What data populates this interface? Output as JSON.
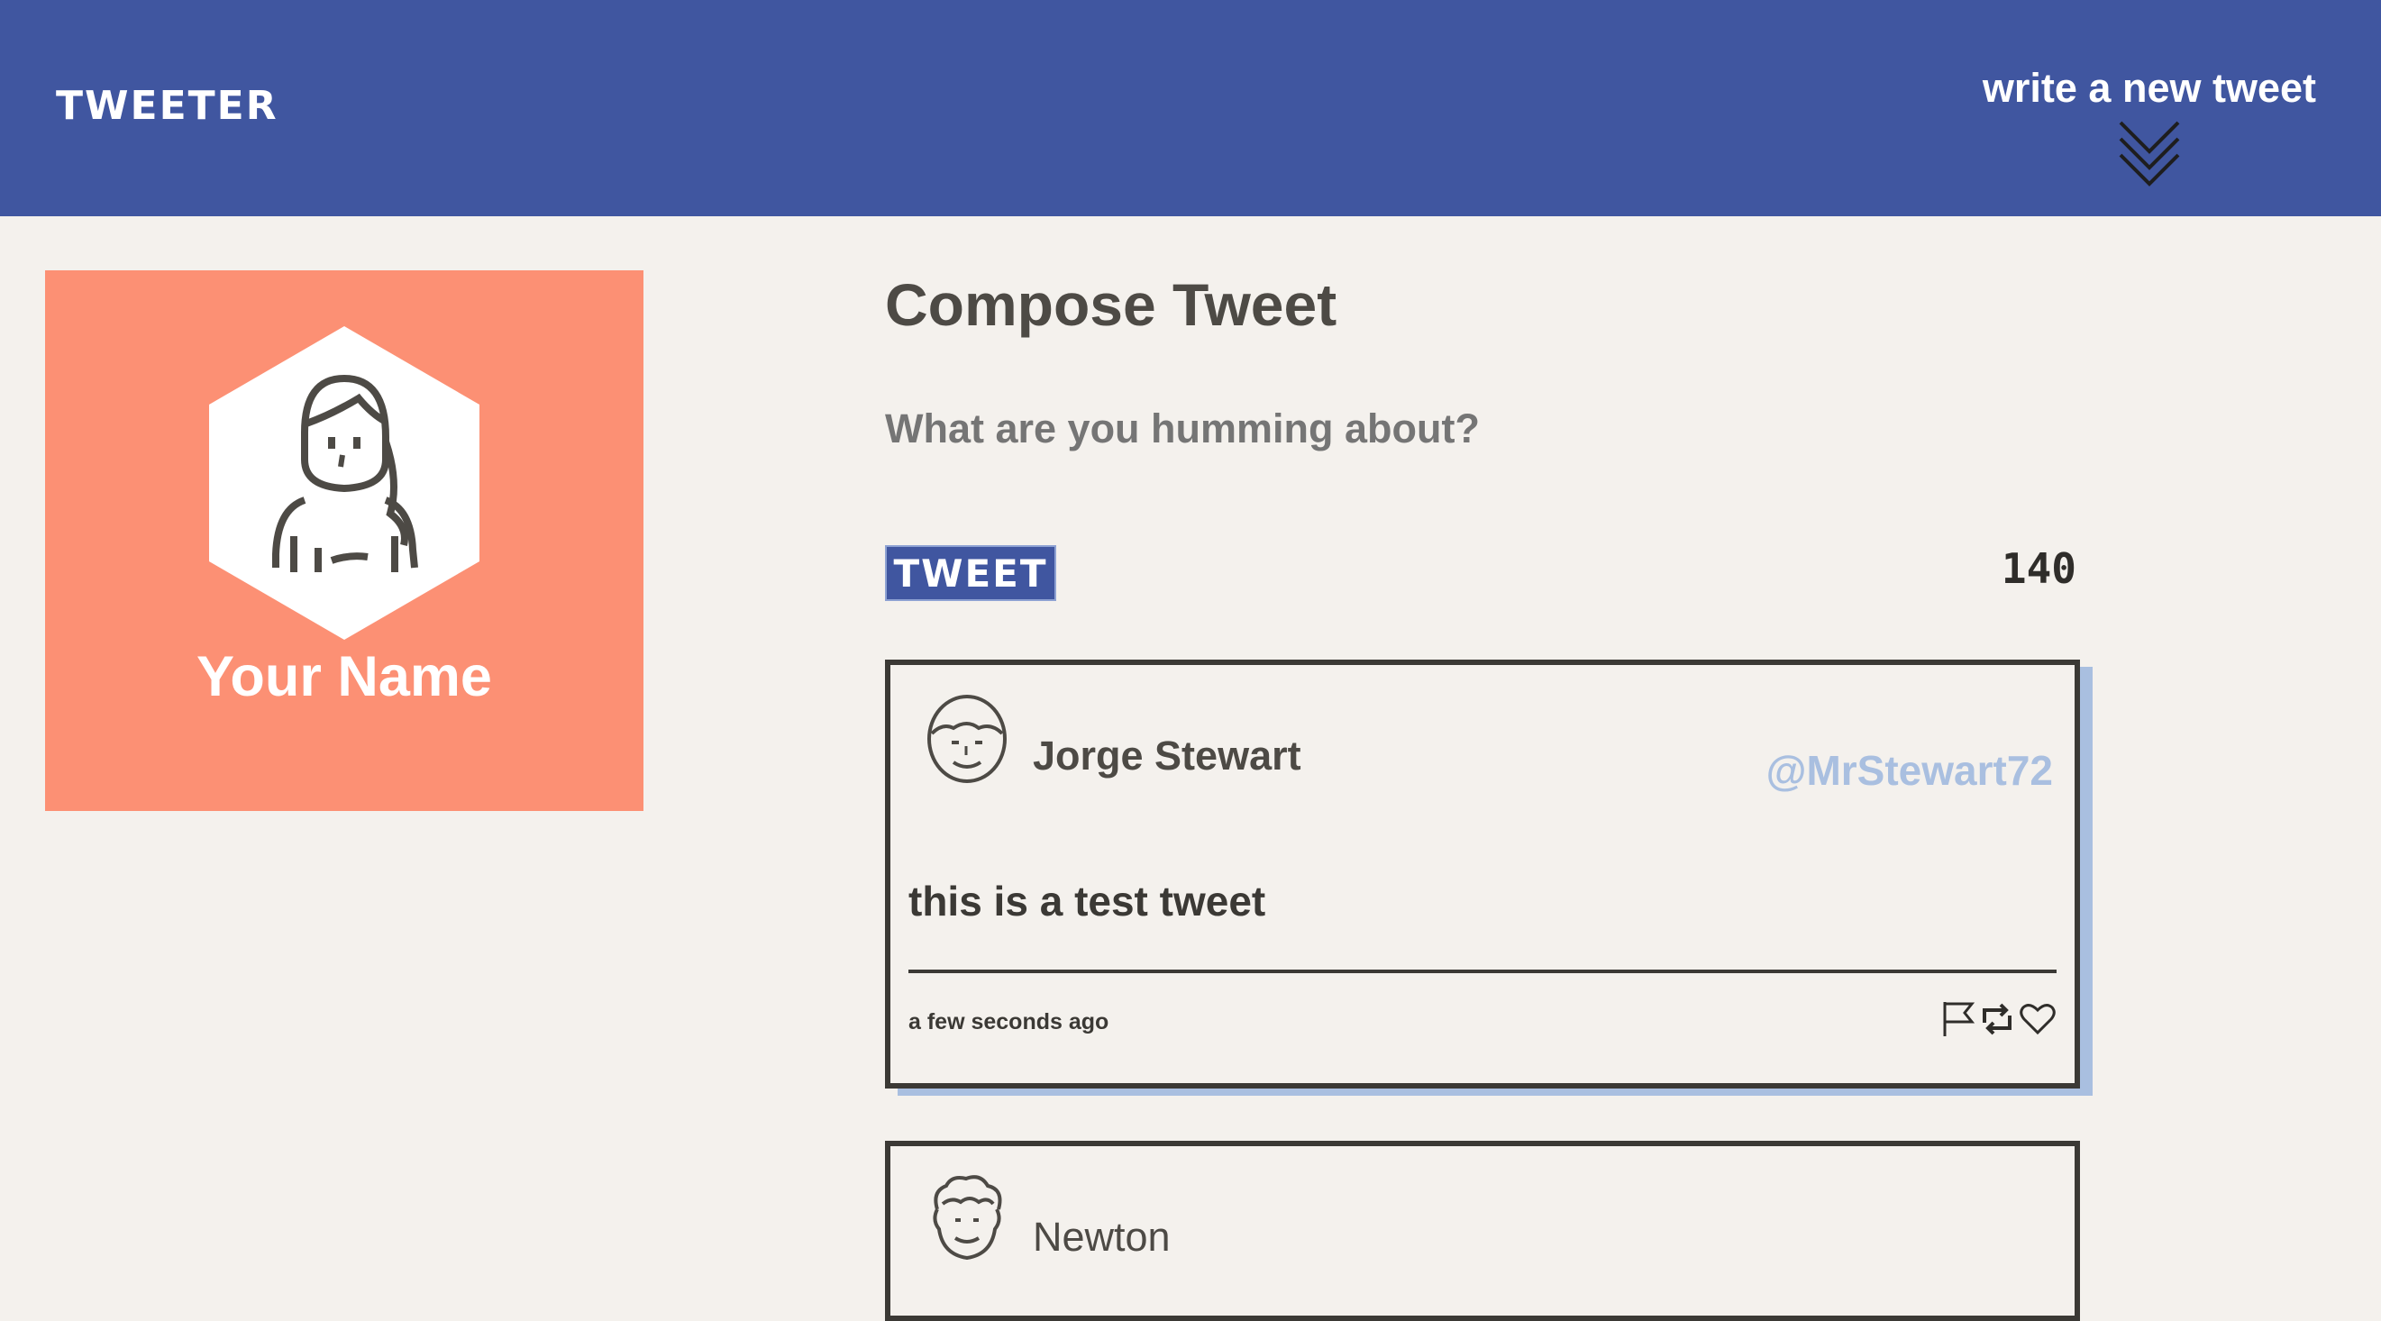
{
  "nav": {
    "brand": "TWEETER",
    "new_tweet_label": "write a new tweet",
    "new_tweet_icon": "double-chevron-down-icon"
  },
  "profile": {
    "name": "Your Name",
    "avatar_icon": "user-avatar-icon",
    "card_color": "#fc9074"
  },
  "compose": {
    "title": "Compose Tweet",
    "placeholder": "What are you humming about?",
    "button_label": "TWEET",
    "counter": "140"
  },
  "tweets": [
    {
      "author": "Jorge Stewart",
      "handle": "@MrStewart72",
      "content": "this is a test tweet",
      "timestamp": "a few seconds ago",
      "actions": [
        "flag-icon",
        "retweet-icon",
        "heart-icon"
      ]
    },
    {
      "author": "Newton",
      "handle": "",
      "content": "",
      "timestamp": ""
    }
  ],
  "colors": {
    "nav": "#4056a0",
    "background": "#f4f1ed",
    "accent": "#a9bfe0",
    "text": "#4d4a45"
  }
}
